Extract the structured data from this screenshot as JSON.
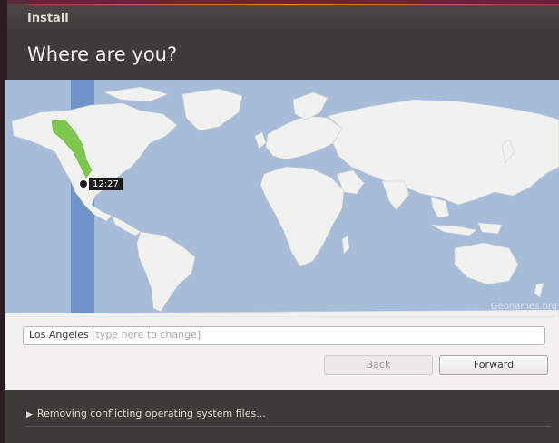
{
  "window": {
    "title": "Install"
  },
  "page": {
    "heading": "Where are you?"
  },
  "map": {
    "selected_time": "12:27",
    "watermark": "Geonames.org",
    "colors": {
      "ocean": "#a7bcd8",
      "land": "#f1f1ef",
      "timezone_band": "#6e93c9",
      "highlight": "#7ec850"
    }
  },
  "location": {
    "value": "Los Angeles",
    "hint": "[type here to change]"
  },
  "buttons": {
    "back": "Back",
    "forward": "Forward"
  },
  "status": {
    "expander_icon": "triangle-right-icon",
    "text": "Removing conflicting operating system files..."
  }
}
